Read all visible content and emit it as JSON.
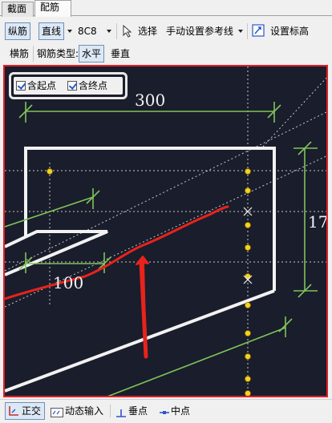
{
  "tabs": [
    {
      "label": "截面"
    },
    {
      "label": "配筋"
    }
  ],
  "toolbar": {
    "longitudinal": "纵筋",
    "straight_line": "直线",
    "rebar_spec": "8C8",
    "select": "选择",
    "manual_ref_line": "手动设置参考线",
    "set_elevation": "设置标高"
  },
  "toolbar2": {
    "transverse": "横筋",
    "rebar_type_label": "钢筋类型:",
    "horizontal": "水平",
    "vertical": "垂直"
  },
  "options": {
    "include_start": "含起点",
    "include_end": "含终点"
  },
  "dimensions": {
    "top_width": "300",
    "left_offset": "100",
    "right_height": "17"
  },
  "statusbar": {
    "ortho": "正交",
    "dynamic_input": "动态输入",
    "perpendicular": "垂点",
    "midpoint": "中点"
  },
  "colors": {
    "canvas_bg": "#1a1d2b",
    "canvas_border": "#e0202a",
    "dimension_green": "#7fc45a",
    "point_yellow": "#f5d21e",
    "annotation_red": "#e8231c"
  }
}
